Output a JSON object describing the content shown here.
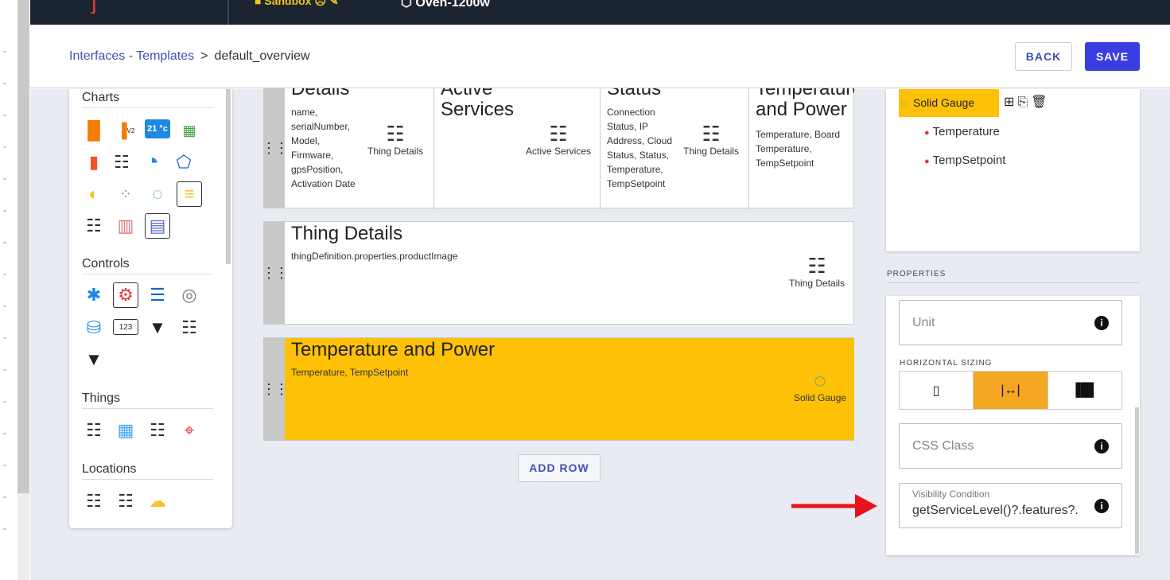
{
  "topbar": {
    "brand_mark": "]",
    "sandbox_label": "Sandbox",
    "device_name": "Oven-1200w"
  },
  "breadcrumb": {
    "parent": "Interfaces - Templates",
    "separator": ">",
    "current": "default_overview"
  },
  "actions": {
    "back": "BACK",
    "save": "SAVE"
  },
  "palette": {
    "charts_title": "Charts",
    "controls_title": "Controls",
    "things_title": "Things",
    "locations_title": "Locations",
    "chart_icon_text": "21 °c",
    "v2_label": "V2",
    "counter_text": "123"
  },
  "rows": [
    {
      "cells": [
        {
          "title": "Details",
          "text": "name, serialNumber, Model, Firmware, gpsPosition, Activation Date",
          "widget": "Thing Details"
        },
        {
          "title": "Active Services",
          "text": "",
          "widget": "Active Services"
        },
        {
          "title": "Status",
          "text": "Connection Status, IP Address, Cloud Status, Status, Temperature, TempSetpoint",
          "widget": "Thing Details"
        },
        {
          "title": "Temperature and Power",
          "text": "Temperature, Board Temperature, TempSetpoint",
          "widget": ""
        }
      ]
    },
    {
      "title": "Thing Details",
      "text": "thingDefinition.properties.productImage",
      "widget": "Thing Details"
    },
    {
      "title": "Temperature and Power",
      "text": "Temperature, TempSetpoint",
      "widget": "Solid Gauge"
    }
  ],
  "add_row": "ADD ROW",
  "tree": {
    "selected": "Solid Gauge",
    "items": [
      "Temperature",
      "TempSetpoint"
    ]
  },
  "properties": {
    "section": "PROPERTIES",
    "unit_placeholder": "Unit",
    "horizontal_sizing": "HORIZONTAL SIZING",
    "css_placeholder": "CSS Class",
    "visibility_label": "Visibility Condition",
    "visibility_value": "getServiceLevel()?.features?.",
    "info": "i"
  },
  "colors": {
    "accent": "#3a3de0",
    "selected": "#ffc107",
    "topbar": "#1b2431",
    "arrow": "#e8131b"
  }
}
